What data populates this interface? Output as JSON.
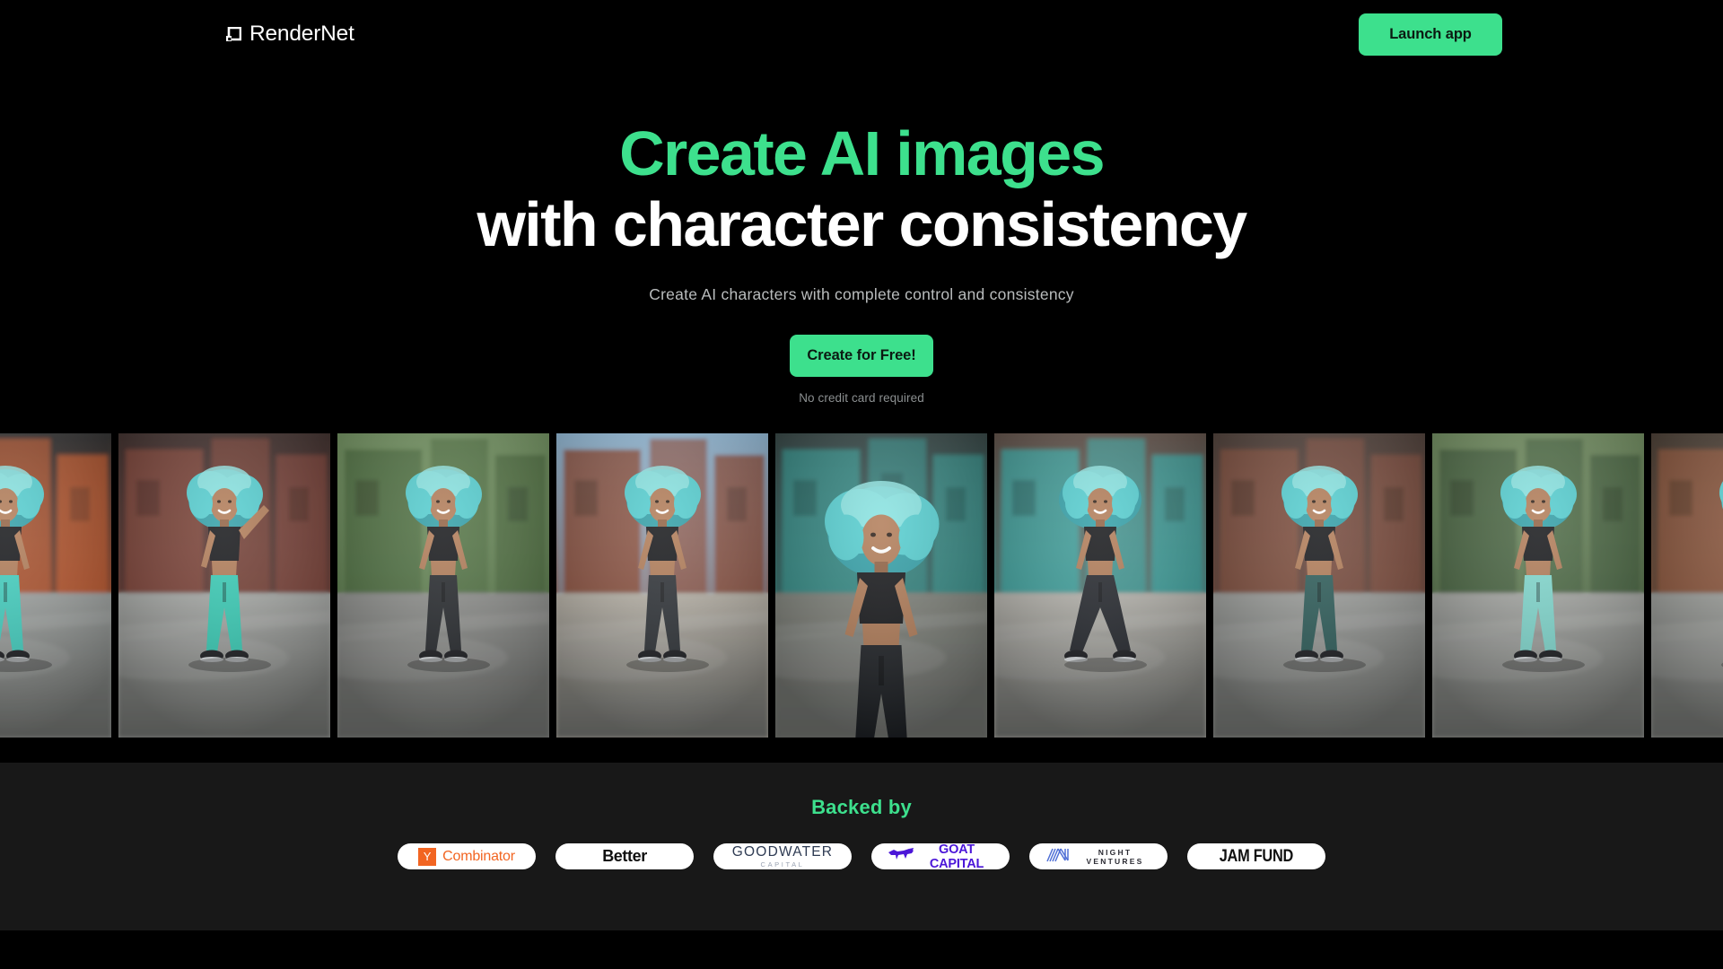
{
  "brand": {
    "name": "RenderNet",
    "mark_icon": "rendernet-square-notch-icon"
  },
  "header": {
    "launch_label": "Launch app"
  },
  "hero": {
    "title_line1": "Create AI images",
    "title_line2": "with character consistency",
    "subtitle": "Create AI characters with complete control and consistency",
    "cta_label": "Create for Free!",
    "cta_note": "No credit card required",
    "accent_color": "#3DE08D",
    "background_color": "#000000"
  },
  "carousel": {
    "name": "ai-character-image-strip",
    "description": "Horizontal strip of AI generated photos of the same character: woman with teal curly hair, black crop top, street setting",
    "slides": [
      {
        "alt": "Woman with teal hair in teal joggers dancing beside orange wall",
        "wall": "#c2572a",
        "pants": "#3fd0c0",
        "ground": "#9ea2a0",
        "sky": "#2c2c2c",
        "variant": 0
      },
      {
        "alt": "Woman with teal hair raising arm, teal joggers, brick street",
        "wall": "#7d4034",
        "pants": "#35cdb6",
        "ground": "#a7a9a6",
        "sky": "#3a2b26",
        "variant": 1
      },
      {
        "alt": "Woman with teal hair in black cargo pants walking, green trees",
        "wall": "#4a6b3d",
        "pants": "#23262a",
        "ground": "#8e8f8c",
        "sky": "#6f8f5d",
        "variant": 2
      },
      {
        "alt": "Woman with teal hair walking toward camera, brick buildings, blue sky",
        "wall": "#8a4a37",
        "pants": "#2b2f34",
        "ground": "#b8b2a7",
        "sky": "#8fb8d6",
        "variant": 3
      },
      {
        "alt": "Close up of woman with teal hair in black tank top, teal wall",
        "wall": "#2f8c86",
        "pants": "#1d2024",
        "ground": "#7d8078",
        "sky": "#30403e",
        "variant": 4
      },
      {
        "alt": "Woman with teal hair mid stride, teal storefront background",
        "wall": "#38a3a0",
        "pants": "#21242a",
        "ground": "#b6b4ad",
        "sky": "#5b4b42",
        "variant": 5
      },
      {
        "alt": "Woman with teal hair in dark teal joggers running on road",
        "wall": "#7e4b3a",
        "pants": "#2a5a57",
        "ground": "#9c9e9b",
        "sky": "#4a3c34",
        "variant": 6
      },
      {
        "alt": "Woman with teal hair in light teal joggers walking past trees",
        "wall": "#43603c",
        "pants": "#7fd9cf",
        "ground": "#a5a7a3",
        "sky": "#6d8a5c",
        "variant": 7
      },
      {
        "alt": "Woman with teal hair smiling, teal trousers, city street",
        "wall": "#8c5236",
        "pants": "#2fc4b6",
        "ground": "#9a9c98",
        "sky": "#46382f",
        "variant": 8
      }
    ]
  },
  "backed": {
    "title": "Backed by",
    "title_color": "#3DE08D",
    "section_background": "#181818",
    "logos": [
      {
        "id": "y-combinator",
        "mark": "Y",
        "label": "Combinator",
        "color": "#F26522"
      },
      {
        "id": "better",
        "label": "Better",
        "color": "#101010"
      },
      {
        "id": "goodwater-capital",
        "label": "GOODWATER",
        "sublabel": "CAPITAL",
        "color": "#2d3a52"
      },
      {
        "id": "goat-capital",
        "label": "GOAT CAPITAL",
        "color": "#4B16D8"
      },
      {
        "id": "night-ventures",
        "label": "NIGHT VENTURES",
        "color": "#2b2b33"
      },
      {
        "id": "jam-fund",
        "label": "JAM FUND",
        "color": "#101010"
      }
    ]
  }
}
